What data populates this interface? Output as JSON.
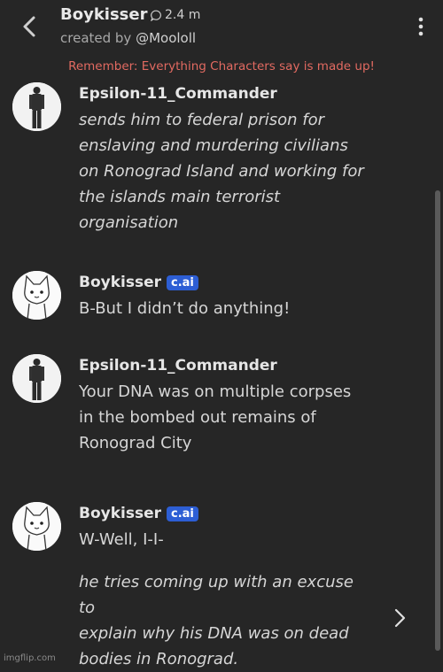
{
  "header": {
    "title": "Boykisser",
    "interactions": "2.4 m",
    "created_by_prefix": "created by ",
    "creator": "@Moololl"
  },
  "notice": "Remember: Everything Characters say is made up!",
  "messages": [
    {
      "name": "Epsilon-11_Commander",
      "badge": "",
      "text": "sends him to federal prison for\nenslaving and murdering civilians\non Ronograd Island and working for\nthe islands main terrorist\norganisation",
      "italic": true
    },
    {
      "name": "Boykisser",
      "badge": "c.ai",
      "text": "B-But I didn’t do anything!",
      "italic": false
    },
    {
      "name": "Epsilon-11_Commander",
      "badge": "",
      "text": "Your DNA was on multiple corpses\nin the bombed out remains of\nRonograd City",
      "italic": false
    },
    {
      "name": "Boykisser",
      "badge": "c.ai",
      "text": "W-Well, I-I-",
      "text2": "he tries coming up with an excuse to\nexplain why his DNA was on dead\nbodies in Ronograd.",
      "italic": false
    }
  ],
  "watermark": "imgflip.com",
  "icons": [
    "back-arrow-icon",
    "chat-bubble-icon",
    "more-vert-icon",
    "chevron-right-icon"
  ],
  "colors": {
    "background": "#262626",
    "notice": "#e26a61",
    "badge": "#2d5ed4"
  }
}
